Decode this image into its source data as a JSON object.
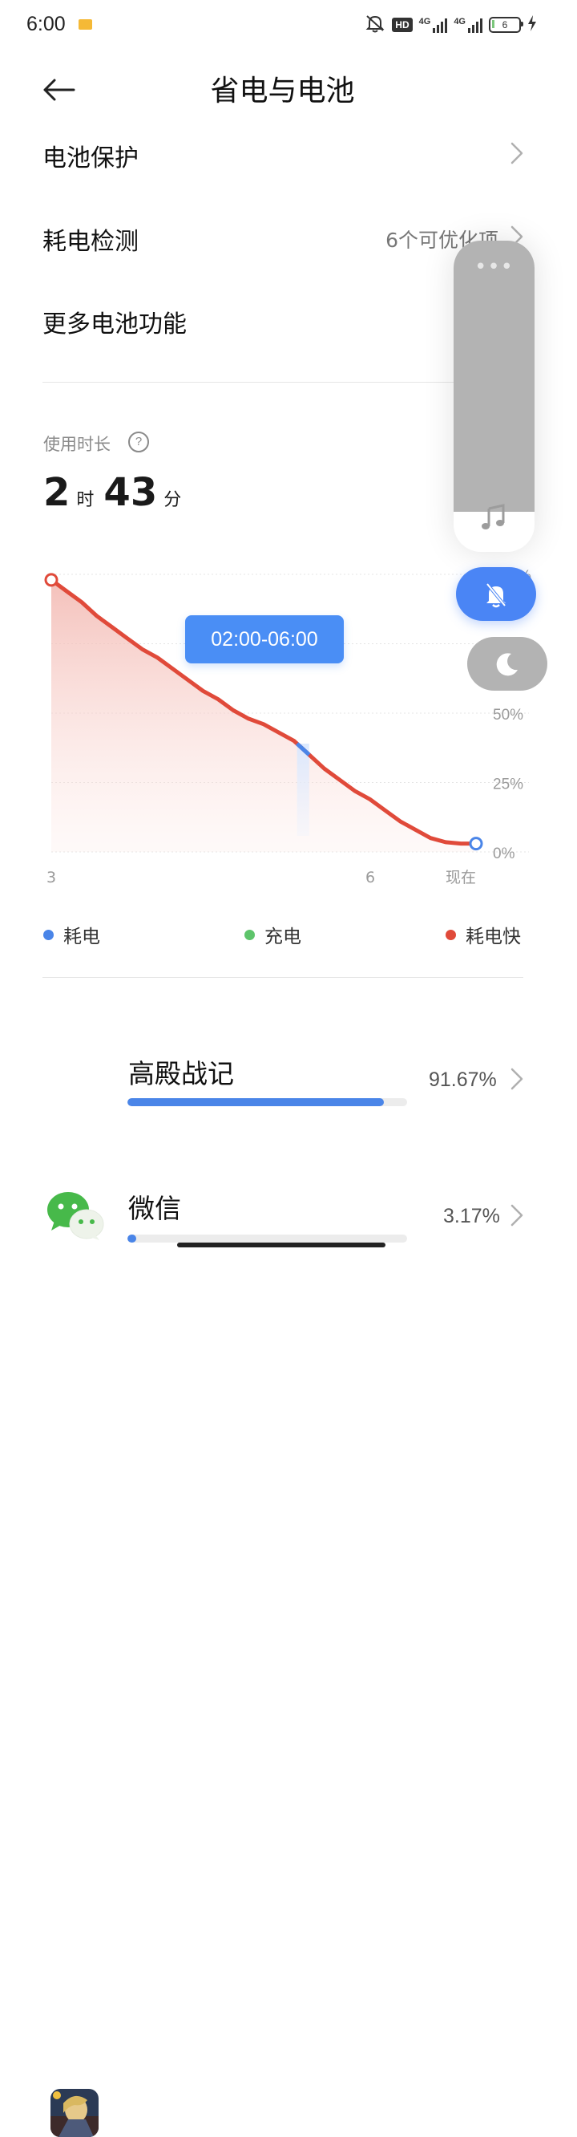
{
  "status_bar": {
    "time": "6:00",
    "network_label_1": "4G",
    "network_label_2": "4G",
    "hd_label": "HD",
    "battery_level": "6"
  },
  "header": {
    "title": "省电与电池"
  },
  "menu": [
    {
      "label": "电池保护",
      "value": ""
    },
    {
      "label": "耗电检测",
      "value": "6个可优化项"
    },
    {
      "label": "更多电池功能",
      "value": ""
    }
  ],
  "usage": {
    "label": "使用时长",
    "hours": "2",
    "hours_unit": "时",
    "minutes": "43",
    "minutes_unit": "分"
  },
  "chart_tooltip": "02:00-06:00",
  "chart_data": {
    "type": "area",
    "x_tick_labels": [
      "3",
      "6",
      "现在"
    ],
    "y_tick_labels": [
      "0%",
      "25%",
      "50%",
      "%"
    ],
    "ylim": [
      0,
      100
    ],
    "x": [
      0,
      0.25,
      0.5,
      0.75,
      1,
      1.25,
      1.5,
      1.75,
      2,
      2.25,
      2.5,
      2.75,
      3,
      3.25,
      3.5,
      3.75,
      4,
      4.25,
      4.5,
      4.75,
      5,
      5.25,
      5.5,
      5.75,
      6,
      6.25,
      6.5,
      6.75,
      7
    ],
    "series": [
      {
        "values": [
          98,
          94,
          90,
          85,
          81,
          77,
          73,
          70,
          66,
          62,
          58,
          55,
          51,
          48,
          46,
          43,
          40,
          35,
          30,
          26,
          22,
          19,
          15,
          11,
          8,
          5,
          3.5,
          3,
          3
        ]
      }
    ],
    "legend": [
      "耗电",
      "充电",
      "耗电快"
    ],
    "colors": {
      "consume": "#4a85e8",
      "charge": "#5ec46b",
      "fast": "#e04a3a"
    }
  },
  "legend": {
    "consume": "耗电",
    "charge": "充电",
    "fast": "耗电快"
  },
  "apps": [
    {
      "name": "高殿战记",
      "percent": "91.67%",
      "share": 0.9167,
      "icon": "game-icon"
    },
    {
      "name": "微信",
      "percent": "3.17%",
      "share": 0.0317,
      "icon": "wechat-icon"
    }
  ],
  "panel": {
    "menu_glyph": "•••",
    "volume_level": 0.13
  }
}
